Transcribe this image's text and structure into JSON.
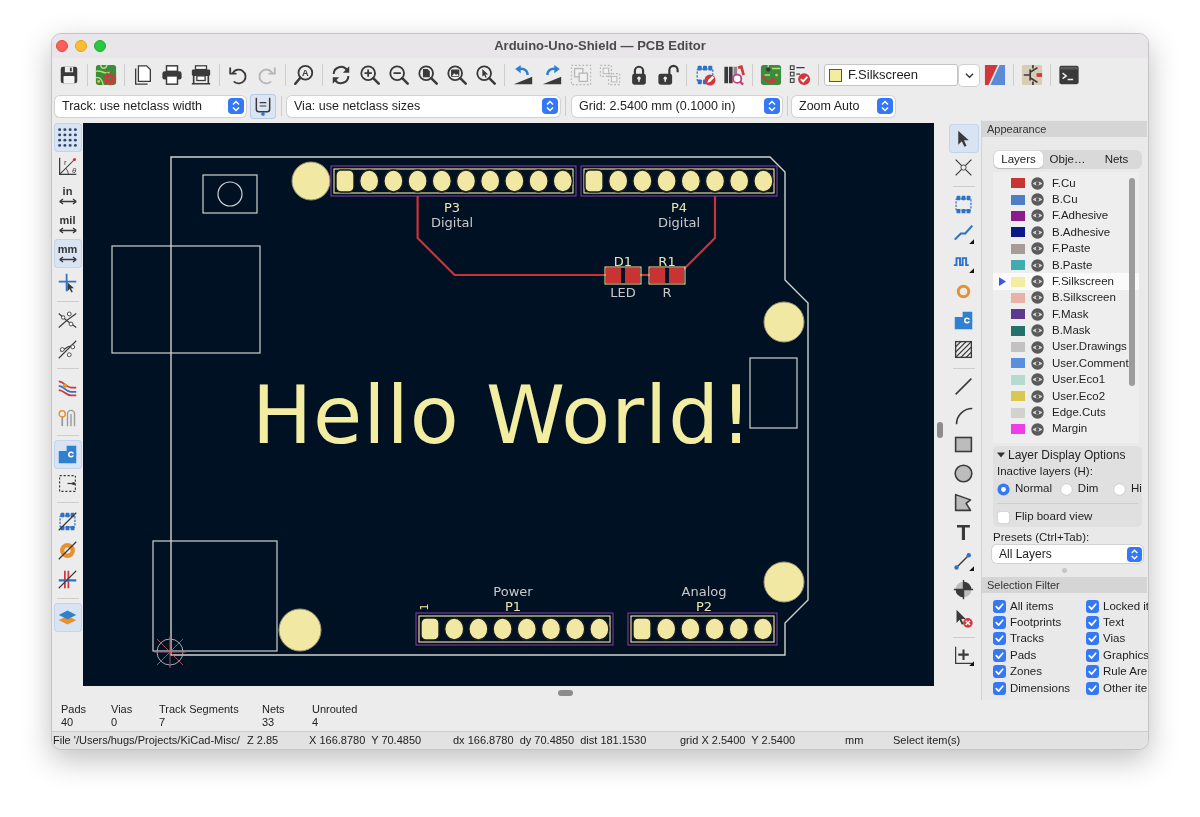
{
  "window": {
    "title": "Arduino-Uno-Shield — PCB Editor"
  },
  "main_toolbar": {
    "groups": [
      {
        "items": [
          {
            "kind": "save",
            "disabled": false
          }
        ]
      },
      {
        "items": [
          {
            "kind": "board_setup",
            "disabled": false
          }
        ]
      },
      {
        "items": [
          {
            "kind": "page",
            "disabled": false
          },
          {
            "kind": "print",
            "disabled": false
          },
          {
            "kind": "plot",
            "disabled": false
          }
        ]
      },
      {
        "items": [
          {
            "kind": "undo",
            "disabled": false
          },
          {
            "kind": "redo",
            "disabled": true
          }
        ]
      },
      {
        "items": [
          {
            "kind": "find",
            "glyphs": [
              "A"
            ],
            "disabled": false
          }
        ]
      },
      {
        "items": [
          {
            "kind": "refresh",
            "disabled": false
          },
          {
            "kind": "zoom_in",
            "disabled": false
          },
          {
            "kind": "zoom_out",
            "disabled": false
          },
          {
            "kind": "zoom_fit",
            "disabled": false
          },
          {
            "kind": "zoom_objects",
            "disabled": false
          },
          {
            "kind": "zoom_selection",
            "disabled": false
          }
        ]
      },
      {
        "items": [
          {
            "kind": "rotate_ccw",
            "disabled": false
          },
          {
            "kind": "rotate_cw",
            "disabled": false
          },
          {
            "kind": "group",
            "disabled": true
          },
          {
            "kind": "ungroup",
            "disabled": true
          },
          {
            "kind": "lock",
            "disabled": false
          },
          {
            "kind": "unlock",
            "disabled": false
          }
        ]
      },
      {
        "items": [
          {
            "kind": "footprint_editor",
            "disabled": false
          },
          {
            "kind": "library_browser",
            "disabled": false
          }
        ]
      },
      {
        "items": [
          {
            "kind": "update_pcb",
            "disabled": false
          },
          {
            "kind": "drc",
            "disabled": false
          }
        ]
      }
    ],
    "layer_selector": {
      "value": "F.Silkscreen"
    },
    "trailing_groups": [
      {
        "items": [
          {
            "kind": "layer_pair",
            "disabled": false
          }
        ]
      },
      {
        "items": [
          {
            "kind": "scripting",
            "disabled": false
          }
        ]
      },
      {
        "items": [
          {
            "kind": "terminal",
            "disabled": false
          }
        ]
      }
    ]
  },
  "options_toolbar": {
    "track_width": "Track: use netclass width",
    "auto_track_width": {
      "on": true
    },
    "via_size": "Via: use netclass sizes",
    "grid": "Grid: 2.5400 mm (0.1000 in)",
    "zoom": "Zoom Auto"
  },
  "left_toolbar": {
    "groups": [
      {
        "items": [
          {
            "kind": "grid",
            "on": true
          },
          {
            "kind": "polar",
            "glyphs": [
              "r",
              "θ"
            ],
            "on": false
          },
          {
            "kind": "units",
            "label": "in",
            "on": false
          },
          {
            "kind": "units",
            "label": "mil",
            "on": false
          },
          {
            "kind": "units",
            "label": "mm",
            "on": true
          },
          {
            "kind": "cursor",
            "on": false
          }
        ]
      },
      {
        "items": [
          {
            "kind": "ratsnest",
            "on": false
          },
          {
            "kind": "curved_ratsnest",
            "on": false
          }
        ]
      },
      {
        "items": [
          {
            "kind": "track_outline",
            "on": false
          },
          {
            "kind": "pad_outline",
            "on": false
          }
        ]
      },
      {
        "items": [
          {
            "kind": "zone_fill",
            "on": true
          },
          {
            "kind": "zone_outline",
            "on": false
          }
        ]
      },
      {
        "items": [
          {
            "kind": "footprint_outline",
            "on": false
          },
          {
            "kind": "via_outline",
            "on": false
          },
          {
            "kind": "crosshair",
            "on": false
          }
        ]
      },
      {
        "items": [
          {
            "kind": "layers_manager",
            "on": true
          }
        ]
      }
    ]
  },
  "pcb_view": {
    "footprints": [
      {
        "reference": "P3",
        "value": "Digital"
      },
      {
        "reference": "P4",
        "value": "Digital"
      },
      {
        "reference": "D1",
        "value": "LED"
      },
      {
        "reference": "R1",
        "value": "R"
      },
      {
        "reference": "P1",
        "value": "Power",
        "pin_label": "1"
      },
      {
        "reference": "P2",
        "value": "Analog"
      }
    ],
    "text": "Hello World!"
  },
  "right_toolbar": {
    "groups": [
      {
        "items": [
          {
            "kind": "select",
            "on": true
          },
          {
            "kind": "local_ratsnest",
            "on": false
          }
        ]
      },
      {
        "items": [
          {
            "kind": "footprint",
            "on": false
          },
          {
            "kind": "route",
            "on": false
          },
          {
            "kind": "tune",
            "on": false
          },
          {
            "kind": "via",
            "on": false
          },
          {
            "kind": "zone",
            "on": false
          },
          {
            "kind": "rule_area",
            "on": false
          }
        ]
      },
      {
        "items": [
          {
            "kind": "line",
            "on": false
          },
          {
            "kind": "arc",
            "on": false
          },
          {
            "kind": "rectangle",
            "on": false
          },
          {
            "kind": "circle",
            "on": false
          },
          {
            "kind": "polygon",
            "on": false
          },
          {
            "kind": "text",
            "glyphs": [
              "T"
            ],
            "on": false
          },
          {
            "kind": "dimension",
            "on": false
          },
          {
            "kind": "drill_origin",
            "on": false
          },
          {
            "kind": "delete",
            "on": false
          }
        ]
      },
      {
        "items": [
          {
            "kind": "grid_origin",
            "on": false
          }
        ]
      }
    ]
  },
  "appearance": {
    "title": "Appearance",
    "tabs": [
      {
        "label": "Layers",
        "selected": true
      },
      {
        "label": "Obje…",
        "selected": false
      },
      {
        "label": "Nets",
        "selected": false
      }
    ],
    "layers": [
      {
        "name": "F.Cu",
        "color": "#c83434",
        "visible": true,
        "selected": false
      },
      {
        "name": "B.Cu",
        "color": "#4d7fc4",
        "visible": true,
        "selected": false
      },
      {
        "name": "F.Adhesive",
        "color": "#8a1c8c",
        "visible": true,
        "selected": false
      },
      {
        "name": "B.Adhesive",
        "color": "#0a1888",
        "visible": true,
        "selected": false
      },
      {
        "name": "F.Paste",
        "color": "#a69b97",
        "visible": true,
        "selected": false
      },
      {
        "name": "B.Paste",
        "color": "#3fadad",
        "visible": true,
        "selected": false
      },
      {
        "name": "F.Silkscreen",
        "color": "#f2eda1",
        "visible": true,
        "selected": true
      },
      {
        "name": "B.Silkscreen",
        "color": "#e8b2a7",
        "visible": true,
        "selected": false
      },
      {
        "name": "F.Mask",
        "color": "#5e3a8c",
        "visible": true,
        "selected": false
      },
      {
        "name": "B.Mask",
        "color": "#24706a",
        "visible": true,
        "selected": false
      },
      {
        "name": "User.Drawings",
        "color": "#c2c2c2",
        "visible": true,
        "selected": false
      },
      {
        "name": "User.Comment",
        "color": "#5990dd",
        "visible": true,
        "selected": false
      },
      {
        "name": "User.Eco1",
        "color": "#b4dbd2",
        "visible": true,
        "selected": false
      },
      {
        "name": "User.Eco2",
        "color": "#d8c852",
        "visible": true,
        "selected": false
      },
      {
        "name": "Edge.Cuts",
        "color": "#d0d2cd",
        "visible": true,
        "selected": false
      },
      {
        "name": "Margin",
        "color": "#f03ee6",
        "visible": true,
        "selected": false
      }
    ],
    "display_options": {
      "title": "Layer Display Options",
      "expanded": true,
      "inactive_label": "Inactive layers (H):",
      "modes": [
        {
          "label": "Normal",
          "selected": true
        },
        {
          "label": "Dim",
          "selected": false
        },
        {
          "label": "Hi",
          "selected": false
        }
      ],
      "flip_board": {
        "label": "Flip board view",
        "checked": false
      }
    },
    "presets": {
      "label": "Presets (Ctrl+Tab):",
      "value": "All Layers"
    }
  },
  "selection_filter": {
    "title": "Selection Filter",
    "items": [
      {
        "label": "All items",
        "checked": true
      },
      {
        "label": "Locked it",
        "checked": true
      },
      {
        "label": "Footprints",
        "checked": true
      },
      {
        "label": "Text",
        "checked": true
      },
      {
        "label": "Tracks",
        "checked": true
      },
      {
        "label": "Vias",
        "checked": true
      },
      {
        "label": "Pads",
        "checked": true
      },
      {
        "label": "Graphics",
        "checked": true
      },
      {
        "label": "Zones",
        "checked": true
      },
      {
        "label": "Rule Are",
        "checked": true
      },
      {
        "label": "Dimensions",
        "checked": true
      },
      {
        "label": "Other ite",
        "checked": true
      }
    ]
  },
  "message_panel": [
    {
      "label": "Pads",
      "value": "40"
    },
    {
      "label": "Vias",
      "value": "0"
    },
    {
      "label": "Track Segments",
      "value": "7"
    },
    {
      "label": "Nets",
      "value": "33"
    },
    {
      "label": "Unrouted",
      "value": "4"
    }
  ],
  "status_bar": [
    "File '/Users/hugs/Projects/KiCad-Misc/",
    "Z 2.85",
    "X 166.8780  Y 70.4850",
    "dx 166.8780  dy 70.4850  dist 181.1530",
    "grid X 2.5400  Y 2.5400",
    "mm",
    "Select item(s)"
  ]
}
